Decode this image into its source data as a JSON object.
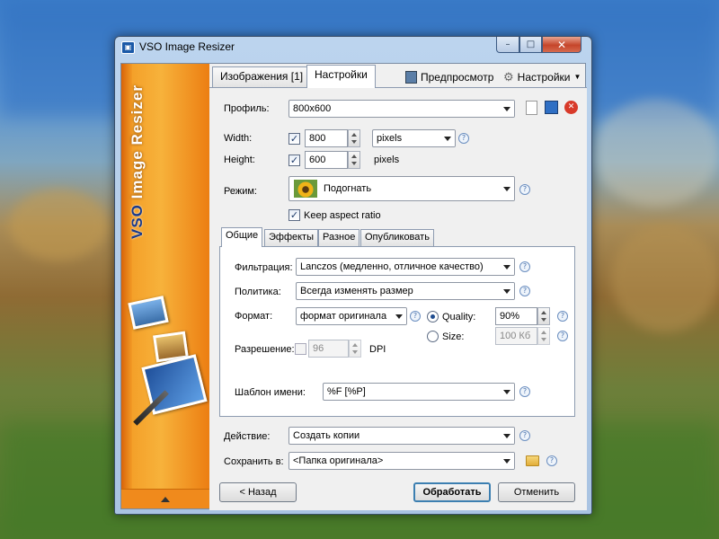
{
  "window": {
    "title": "VSO Image Resizer",
    "minimize": "–",
    "maximize": "□",
    "close": "✕"
  },
  "banner": {
    "brand": "Image Resizer",
    "vso": "VSO"
  },
  "top_tabs": [
    "Изображения [1]",
    "Настройки"
  ],
  "toolbar": {
    "preview": "Предпросмотр",
    "settings": "Настройки"
  },
  "profile": {
    "label": "Профиль:",
    "value": "800x600"
  },
  "width": {
    "label": "Width:",
    "value": "800",
    "unit": "pixels",
    "checked": true
  },
  "height": {
    "label": "Height:",
    "value": "600",
    "unit": "pixels",
    "checked": true
  },
  "mode": {
    "label": "Режим:",
    "value": "Подогнать"
  },
  "keep_aspect": {
    "label": "Keep aspect ratio",
    "checked": true
  },
  "inner_tabs": [
    "Общие",
    "Эффекты",
    "Разное",
    "Опубликовать"
  ],
  "filtration": {
    "label": "Фильтрация:",
    "value": "Lanczos  (медленно, отличное качество)"
  },
  "policy": {
    "label": "Политика:",
    "value": "Всегда изменять размер"
  },
  "format": {
    "label": "Формат:",
    "value": "формат оригинала"
  },
  "quality": {
    "label": "Quality:",
    "value": "90%",
    "selected": true
  },
  "size": {
    "label": "Size:",
    "value": "100 Кб",
    "selected": false
  },
  "resolution": {
    "label": "Разрешение:",
    "value": "96",
    "unit": "DPI",
    "checked": false
  },
  "name_template": {
    "label": "Шаблон имени:",
    "value": "%F [%P]"
  },
  "action": {
    "label": "Действие:",
    "value": "Создать копии"
  },
  "save_to": {
    "label": "Сохранить в:",
    "value": "<Папка оригинала>"
  },
  "buttons": {
    "back": "< Назад",
    "process": "Обработать",
    "cancel": "Отменить"
  },
  "help": "?"
}
